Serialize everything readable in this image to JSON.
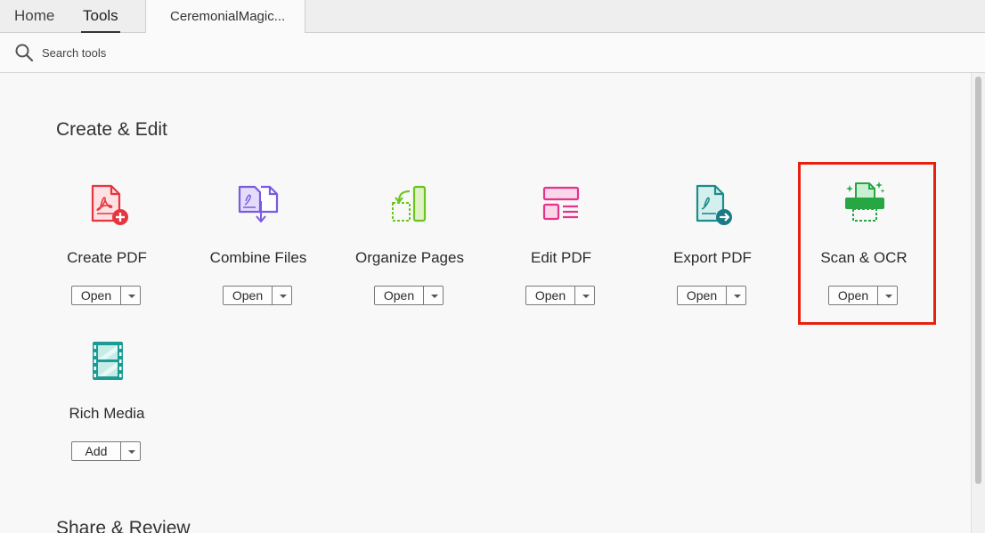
{
  "nav": {
    "home_label": "Home",
    "tools_label": "Tools",
    "document_tab_label": "CeremonialMagic..."
  },
  "search": {
    "placeholder": "Search tools",
    "icon": "search-icon"
  },
  "sections": [
    {
      "title": "Create & Edit",
      "tools": [
        {
          "label": "Create PDF",
          "button": "Open",
          "icon": "create-pdf-icon",
          "color": "#e5353f"
        },
        {
          "label": "Combine Files",
          "button": "Open",
          "icon": "combine-files-icon",
          "color": "#7a5ae0"
        },
        {
          "label": "Organize Pages",
          "button": "Open",
          "icon": "organize-pages-icon",
          "color": "#6cc51f"
        },
        {
          "label": "Edit PDF",
          "button": "Open",
          "icon": "edit-pdf-icon",
          "color": "#e3338b"
        },
        {
          "label": "Export PDF",
          "button": "Open",
          "icon": "export-pdf-icon",
          "color": "#1b8d8a"
        },
        {
          "label": "Scan & OCR",
          "button": "Open",
          "icon": "scan-ocr-icon",
          "color": "#27a644"
        },
        {
          "label": "Rich Media",
          "button": "Add",
          "icon": "rich-media-icon",
          "color": "#1a9b94"
        }
      ]
    },
    {
      "title": "Share & Review"
    }
  ],
  "colors": {
    "highlight": "#e8210f"
  }
}
